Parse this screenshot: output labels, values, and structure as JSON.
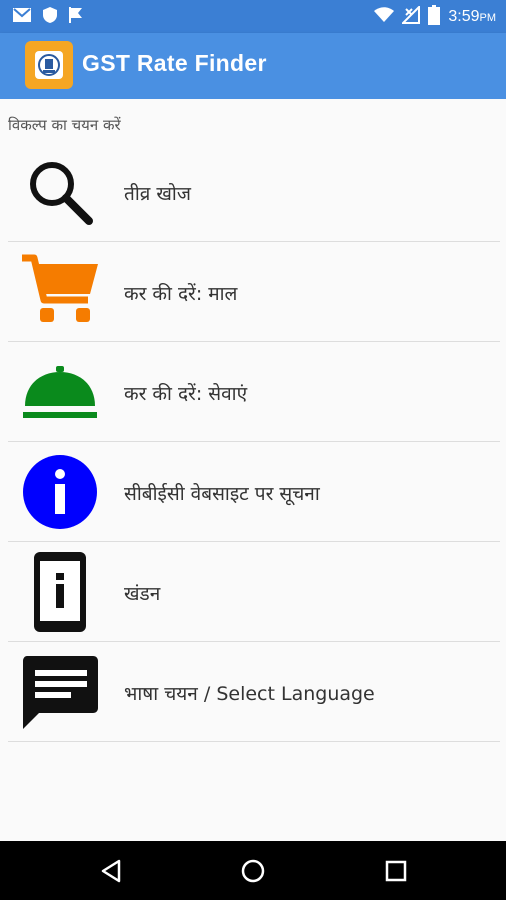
{
  "status_bar": {
    "time": "3:59",
    "ampm": "PM",
    "left_icons": [
      "gmail-icon",
      "shield-icon",
      "flag-icon"
    ],
    "right_icons": [
      "wifi-icon",
      "no-signal-icon",
      "battery-icon"
    ]
  },
  "app_bar": {
    "title": "GST Rate Finder",
    "logo_icon": "cbic-logo-icon",
    "bg_color": "#4a90e2"
  },
  "main": {
    "section_label": "विकल्प का चयन करें",
    "items": [
      {
        "label": "तीव्र खोज",
        "icon": "search-icon"
      },
      {
        "label": "कर की दरें: माल",
        "icon": "cart-icon",
        "icon_color": "#f57c00"
      },
      {
        "label": "कर की दरें: सेवाएं",
        "icon": "service-bell-icon",
        "icon_color": "#0a8a1c"
      },
      {
        "label": "सीबीईसी वेबसाइट पर सूचना",
        "icon": "info-icon",
        "icon_color": "#0000ff"
      },
      {
        "label": "खंडन",
        "icon": "phone-info-icon"
      },
      {
        "label": "भाषा चयन / Select Language",
        "icon": "chat-message-icon"
      }
    ]
  },
  "nav_bar": {
    "buttons": [
      "back-icon",
      "home-icon",
      "recents-icon"
    ]
  }
}
